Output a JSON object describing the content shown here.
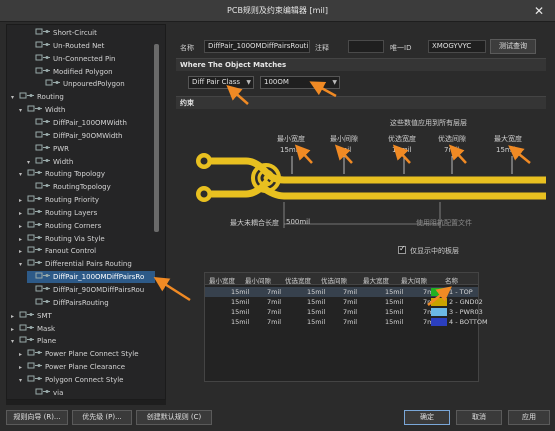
{
  "window": {
    "title": "PCB规则及约束编辑器 [mil]",
    "close_glyph": "✕"
  },
  "tree": {
    "items": [
      {
        "label": "Short-Circuit",
        "level": 2
      },
      {
        "label": "Un-Routed Net",
        "level": 2
      },
      {
        "label": "Un-Connected Pin",
        "level": 2
      },
      {
        "label": "Modified Polygon",
        "level": 2
      },
      {
        "label": "UnpouredPolygon",
        "level": 3
      },
      {
        "label": "Routing",
        "level": 0
      },
      {
        "label": "Width",
        "level": 1
      },
      {
        "label": "DiffPair_100OMWidth",
        "level": 2
      },
      {
        "label": "DiffPair_90OMWidth",
        "level": 2
      },
      {
        "label": "PWR",
        "level": 2
      },
      {
        "label": "Width",
        "level": 2
      },
      {
        "label": "Routing Topology",
        "level": 1
      },
      {
        "label": "RoutingTopology",
        "level": 2
      },
      {
        "label": "Routing Priority",
        "level": 1
      },
      {
        "label": "Routing Layers",
        "level": 1
      },
      {
        "label": "Routing Corners",
        "level": 1
      },
      {
        "label": "Routing Via Style",
        "level": 1
      },
      {
        "label": "Fanout Control",
        "level": 1
      },
      {
        "label": "Differential Pairs Routing",
        "level": 1
      },
      {
        "label": "DiffPair_100OMDiffPairsRo",
        "level": 2
      },
      {
        "label": "DiffPair_90OMDiffPairsRou",
        "level": 2
      },
      {
        "label": "DiffPairsRouting",
        "level": 2
      },
      {
        "label": "SMT",
        "level": 0
      },
      {
        "label": "Mask",
        "level": 0
      },
      {
        "label": "Plane",
        "level": 0
      },
      {
        "label": "Power Plane Connect Style",
        "level": 1
      },
      {
        "label": "Power Plane Clearance",
        "level": 1
      },
      {
        "label": "Polygon Connect Style",
        "level": 1
      },
      {
        "label": "via",
        "level": 2
      }
    ]
  },
  "rule": {
    "name_label": "名称",
    "name_value": "DiffPair_100OMDiffPairsRouting",
    "comment_label": "注释",
    "comment_value": "",
    "id_label": "唯一ID",
    "id_value": "XMOGYVYC",
    "test_button": "测试查询"
  },
  "where": {
    "heading": "Where The Object Matches",
    "scope": "Diff Pair Class",
    "class": "100OM"
  },
  "constraints": {
    "heading": "约束",
    "layer_note": "这些数值应用到所有层层",
    "min_width_label": "最小宽度",
    "min_width": "15mil",
    "min_gap_label": "最小间隙",
    "min_gap": "7mil",
    "pref_width_label": "优选宽度",
    "pref_width": "15mil",
    "pref_gap_label": "优选间隙",
    "pref_gap": "7mil",
    "max_width_label": "最大宽度",
    "max_width": "15mil",
    "max_uncoupled_label": "最大未耦合长度",
    "max_uncoupled_value": "500mil",
    "impedance_note": "使用阻抗配置文件",
    "only_layers_label": "仅显示中的板层"
  },
  "table": {
    "headers": [
      "最小宽度",
      "最小间隙",
      "优选宽度",
      "优选间隙",
      "最大宽度",
      "最大间隙",
      "名称"
    ],
    "rows": [
      {
        "cells": [
          "15mil",
          "7mil",
          "15mil",
          "7mil",
          "15mil",
          "7mil"
        ],
        "layer": "1 - TOP",
        "color": "#22b022"
      },
      {
        "cells": [
          "15mil",
          "7mil",
          "15mil",
          "7mil",
          "15mil",
          "7mil"
        ],
        "layer": "2 - GND02",
        "color": "#c8a300"
      },
      {
        "cells": [
          "15mil",
          "7mil",
          "15mil",
          "7mil",
          "15mil",
          "7mil"
        ],
        "layer": "3 - PWR03",
        "color": "#6bb8e6"
      },
      {
        "cells": [
          "15mil",
          "7mil",
          "15mil",
          "7mil",
          "15mil",
          "7mil"
        ],
        "layer": "4 - BOTTOM",
        "color": "#2b3fbf"
      }
    ]
  },
  "footer": {
    "rule_wizard": "规则向导 (R)...",
    "priority": "优先级 (P)...",
    "create_default": "创建默认规则 (C)",
    "ok": "确定",
    "cancel": "取消",
    "apply": "应用"
  },
  "colors": {
    "accent_arrow": "#f08a24",
    "trace_yellow": "#e8c020",
    "selection_blue": "#2d5a88"
  }
}
